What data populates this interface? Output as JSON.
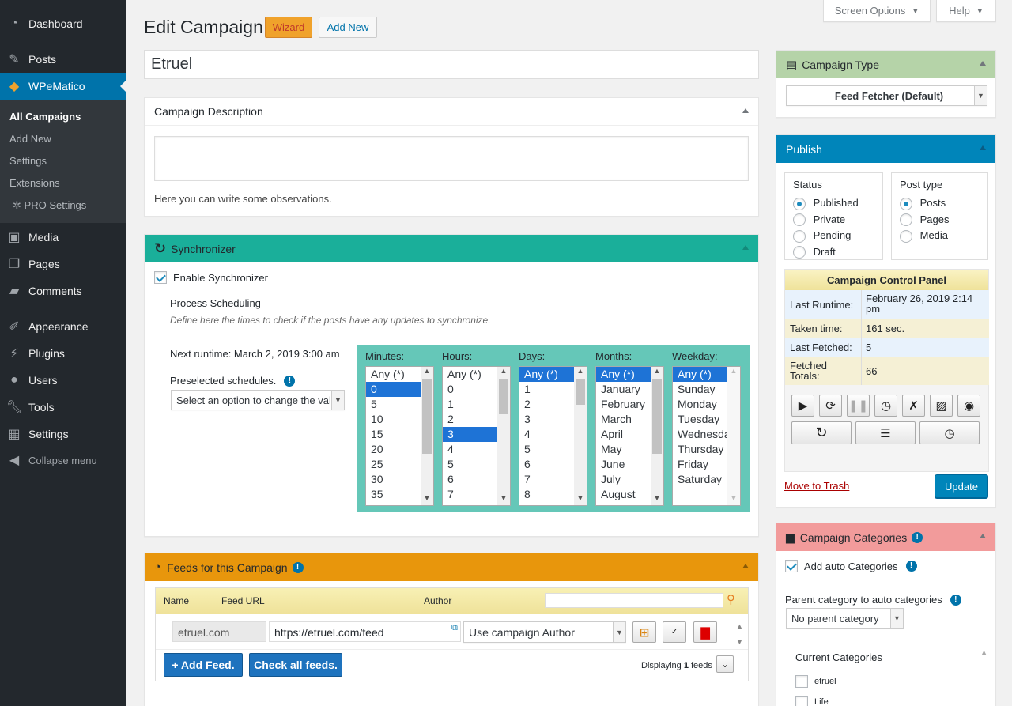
{
  "sidebar": {
    "items": [
      {
        "label": "Dashboard",
        "icon": "dashboard-icon"
      },
      {
        "label": "Posts",
        "icon": "pin-icon"
      },
      {
        "label": "WPeMatico",
        "icon": "wpematico-icon"
      },
      {
        "label": "Media",
        "icon": "media-icon"
      },
      {
        "label": "Pages",
        "icon": "pages-icon"
      },
      {
        "label": "Comments",
        "icon": "comments-icon"
      },
      {
        "label": "Appearance",
        "icon": "brush-icon"
      },
      {
        "label": "Plugins",
        "icon": "plugin-icon"
      },
      {
        "label": "Users",
        "icon": "user-icon"
      },
      {
        "label": "Tools",
        "icon": "wrench-icon"
      },
      {
        "label": "Settings",
        "icon": "settings-icon"
      }
    ],
    "submenu": [
      "All Campaigns",
      "Add New",
      "Settings",
      "Extensions",
      "PRO Settings"
    ],
    "collapse": "Collapse menu"
  },
  "header": {
    "screen_options": "Screen Options",
    "help": "Help",
    "title": "Edit Campaign",
    "wizard": "Wizard",
    "add_new": "Add New",
    "campaign_title": "Etruel"
  },
  "description": {
    "title": "Campaign Description",
    "help": "Here you can write some observations."
  },
  "synchronizer": {
    "title": "Synchronizer",
    "enable_label": "Enable Synchronizer",
    "scheduling_title": "Process Scheduling",
    "scheduling_desc": "Define here the times to check if the posts have any updates to synchronize.",
    "next_runtime": "Next runtime: March 2, 2019 3:00 am",
    "preselected": "Preselected schedules.",
    "preselect_value": "Select an option to change the values.",
    "columns": [
      {
        "label": "Minutes:",
        "options": [
          "Any (*)",
          "0",
          "5",
          "10",
          "15",
          "20",
          "25",
          "30",
          "35"
        ],
        "selected": [
          1
        ]
      },
      {
        "label": "Hours:",
        "options": [
          "Any (*)",
          "0",
          "1",
          "2",
          "3",
          "4",
          "5",
          "6",
          "7"
        ],
        "selected": [
          4
        ]
      },
      {
        "label": "Days:",
        "options": [
          "Any (*)",
          "1",
          "2",
          "3",
          "4",
          "5",
          "6",
          "7",
          "8"
        ],
        "selected": [
          0
        ]
      },
      {
        "label": "Months:",
        "options": [
          "Any (*)",
          "January",
          "February",
          "March",
          "April",
          "May",
          "June",
          "July",
          "August"
        ],
        "selected": [
          0
        ]
      },
      {
        "label": "Weekday:",
        "options": [
          "Any (*)",
          "Sunday",
          "Monday",
          "Tuesday",
          "Wednesday",
          "Thursday",
          "Friday",
          "Saturday"
        ],
        "selected": [
          0
        ]
      }
    ]
  },
  "feeds": {
    "title": "Feeds for this Campaign",
    "col_name": "Name",
    "col_url": "Feed URL",
    "col_author": "Author",
    "row": {
      "name": "etruel.com",
      "url": "https://etruel.com/feed",
      "author": "Use campaign Author"
    },
    "add_feed": "+ Add Feed.",
    "check_all": "Check all feeds.",
    "displaying_prefix": "Displaying",
    "displaying_count": "1",
    "displaying_suffix": "feeds"
  },
  "campaign_type": {
    "title": "Campaign Type",
    "value": "Feed Fetcher (Default)"
  },
  "publish": {
    "title": "Publish",
    "status_label": "Status",
    "statuses": [
      "Published",
      "Private",
      "Pending",
      "Draft"
    ],
    "status_selected": 0,
    "post_type_label": "Post type",
    "post_types": [
      "Posts",
      "Pages",
      "Media"
    ],
    "post_type_selected": 0,
    "control_panel_title": "Campaign Control Panel",
    "rows": [
      {
        "key": "Last Runtime:",
        "value": "February 26, 2019 2:14 pm"
      },
      {
        "key": "Taken time:",
        "value": "161 sec."
      },
      {
        "key": "Last Fetched:",
        "value": "5"
      },
      {
        "key": "Fetched Totals:",
        "value": "66"
      }
    ],
    "trash": "Move to Trash",
    "update": "Update"
  },
  "categories": {
    "title": "Campaign Categories",
    "auto_label": "Add auto Categories",
    "parent_label": "Parent category to auto categories",
    "parent_value": "No parent category",
    "current_label": "Current Categories",
    "items": [
      "etruel",
      "Life"
    ]
  },
  "colors": {
    "admin_bg": "#23282d",
    "accent": "#0073aa",
    "synchronizer": "#1aaf9a",
    "feeds": "#e8960c",
    "campaign_type": "#b5d3a8",
    "categories": "#f29b9b",
    "control_panel": "#f5ecb0"
  }
}
